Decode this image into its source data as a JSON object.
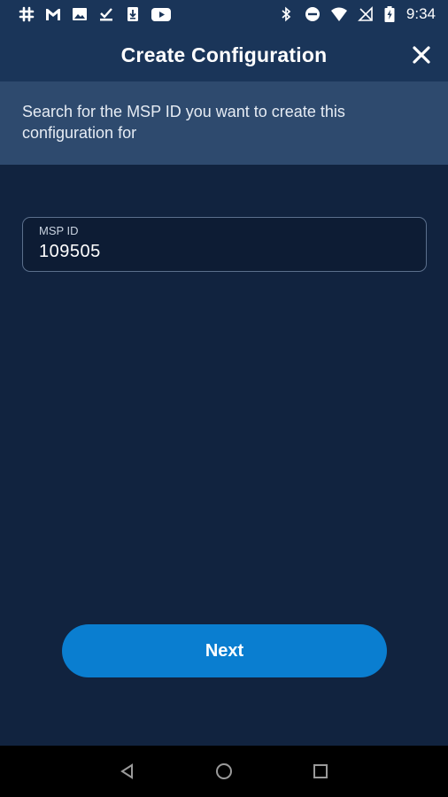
{
  "status_bar": {
    "time": "9:34",
    "left_icons": [
      "slack-icon",
      "gmail-icon",
      "image-icon",
      "download-done-icon",
      "download-icon",
      "youtube-icon"
    ],
    "right_icons": [
      "bluetooth-icon",
      "do-not-disturb-icon",
      "wifi-icon",
      "no-signal-icon",
      "battery-charging-icon"
    ]
  },
  "header": {
    "title": "Create Configuration",
    "close_icon": "close-icon"
  },
  "banner": {
    "text": "Search for the MSP ID you want to create this configuration for"
  },
  "form": {
    "msp_id": {
      "label": "MSP ID",
      "value": "109505"
    }
  },
  "actions": {
    "next_label": "Next"
  },
  "nav_bar": {
    "icons": [
      "back-icon",
      "home-icon",
      "recents-icon"
    ]
  },
  "colors": {
    "background": "#11233f",
    "header": "#1a3559",
    "banner": "#2e4a6e",
    "accent": "#0a7ed0"
  }
}
